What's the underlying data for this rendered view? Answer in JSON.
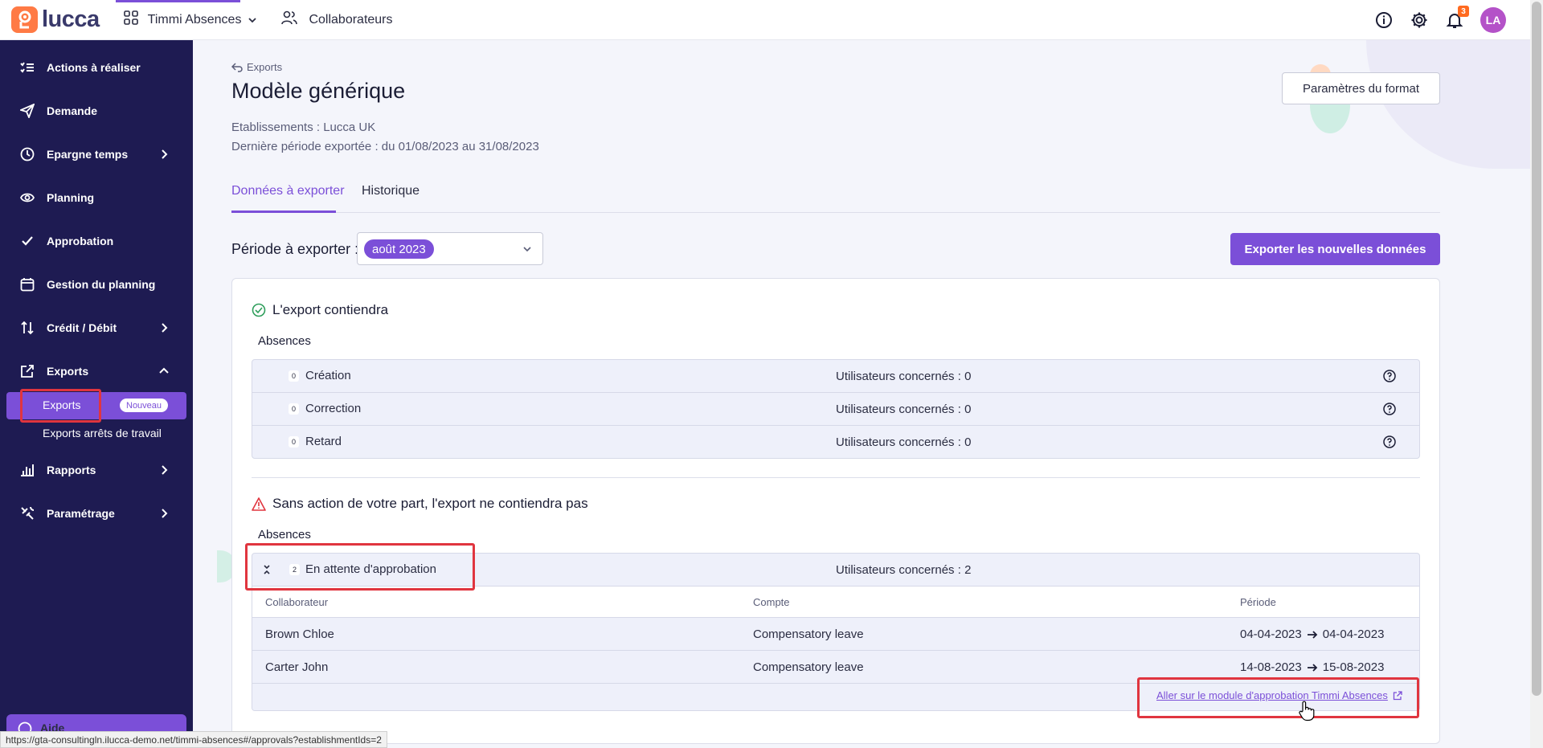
{
  "topbar": {
    "logo_text": "lucca",
    "app_switcher_label": "Timmi Absences",
    "collaborators_label": "Collaborateurs",
    "notification_count": "3",
    "avatar_initials": "LA"
  },
  "sidebar": {
    "items": [
      {
        "label": "Actions à réaliser",
        "icon": "checklist-icon"
      },
      {
        "label": "Demande",
        "icon": "paper-plane-icon"
      },
      {
        "label": "Epargne temps",
        "icon": "clock-icon"
      },
      {
        "label": "Planning",
        "icon": "eye-icon"
      },
      {
        "label": "Approbation",
        "icon": "check-icon"
      },
      {
        "label": "Gestion du planning",
        "icon": "calendar-icon"
      },
      {
        "label": "Crédit / Débit",
        "icon": "arrows-up-down-icon"
      },
      {
        "label": "Exports",
        "icon": "external-link-icon"
      },
      {
        "label": "Rapports",
        "icon": "bar-chart-icon"
      },
      {
        "label": "Paramétrage",
        "icon": "tools-icon"
      }
    ],
    "sub_exports_label": "Exports",
    "sub_exports_badge": "Nouveau",
    "sub_arrets_label": "Exports arrêts de travail",
    "help_label": "Aide"
  },
  "page": {
    "breadcrumb": "Exports",
    "title": "Modèle générique",
    "establishments": "Etablissements : Lucca UK",
    "last_period": "Dernière période exportée : du 01/08/2023 au 31/08/2023",
    "format_settings_button": "Paramètres du format",
    "tabs": [
      "Données à exporter",
      "Historique"
    ],
    "period_label": "Période à exporter :",
    "period_value": "août 2023",
    "export_button": "Exporter les nouvelles données"
  },
  "included": {
    "title": "L'export contiendra",
    "subtitle": "Absences",
    "rows": [
      {
        "count": "0",
        "label": "Création",
        "users": "Utilisateurs concernés : 0"
      },
      {
        "count": "0",
        "label": "Correction",
        "users": "Utilisateurs concernés : 0"
      },
      {
        "count": "0",
        "label": "Retard",
        "users": "Utilisateurs concernés : 0"
      }
    ]
  },
  "excluded": {
    "title": "Sans action de votre part, l'export ne contiendra pas",
    "subtitle": "Absences",
    "group": {
      "count": "2",
      "label": "En attente d'approbation",
      "users": "Utilisateurs concernés : 2"
    },
    "columns": [
      "Collaborateur",
      "Compte",
      "Période"
    ],
    "rows": [
      {
        "collaborator": "Brown Chloe",
        "account": "Compensatory leave",
        "start": "04-04-2023",
        "end": "04-04-2023"
      },
      {
        "collaborator": "Carter John",
        "account": "Compensatory leave",
        "start": "14-08-2023",
        "end": "15-08-2023"
      }
    ],
    "approval_link": "Aller sur le module d'approbation Timmi Absences"
  },
  "status_url": "https://gta-consultingln.ilucca-demo.net/timmi-absences#/approvals?establishmentIds=2",
  "colors": {
    "accent": "#7b4fd8",
    "sidebar": "#1e1b52",
    "logo": "#ff7a45",
    "highlight": "#e0353f"
  }
}
